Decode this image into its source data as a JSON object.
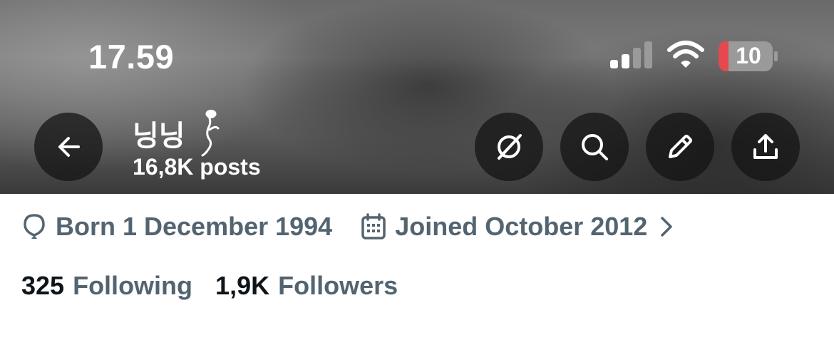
{
  "status_bar": {
    "time": "17.59",
    "battery": "10"
  },
  "header": {
    "name": "닝닝",
    "posts": "16,8K posts"
  },
  "profile": {
    "born": "Born 1 December 1994",
    "joined": "Joined October 2012",
    "following_count": "325",
    "following_label": "Following",
    "followers_count": "1,9K",
    "followers_label": "Followers"
  },
  "colors": {
    "secondary_text": "#536471",
    "primary_text": "#0f1419",
    "battery_low": "#e5484d"
  }
}
